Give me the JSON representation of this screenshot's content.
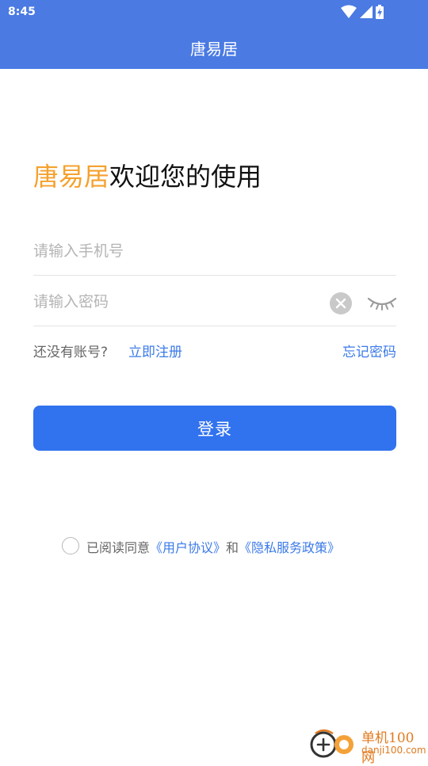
{
  "status_bar": {
    "time": "8:45",
    "icons": [
      "wifi-icon",
      "signal-icon",
      "battery-charging-icon"
    ]
  },
  "app_bar": {
    "title": "唐易居"
  },
  "welcome": {
    "brand": "唐易居",
    "text": "欢迎您的使用"
  },
  "phone_field": {
    "placeholder": "请输入手机号",
    "value": ""
  },
  "password_field": {
    "placeholder": "请输入密码",
    "value": "",
    "clear_icon": "clear-icon",
    "visibility_icon": "eye-closed-icon"
  },
  "links": {
    "no_account": "还没有账号?",
    "register": "立即注册",
    "forgot_password": "忘记密码"
  },
  "login_button": {
    "label": "登录"
  },
  "agreement": {
    "checked": false,
    "prefix": "已阅读同意",
    "user_agreement": "《用户协议》",
    "and": "和",
    "privacy_policy": "《隐私服务政策》"
  },
  "watermark": {
    "line1": "单机100网",
    "line2": "danji100.com"
  },
  "colors": {
    "app_bar": "#4a7ae2",
    "brand": "#f5a12d",
    "link": "#3b7ae8",
    "button": "#3172ee"
  }
}
